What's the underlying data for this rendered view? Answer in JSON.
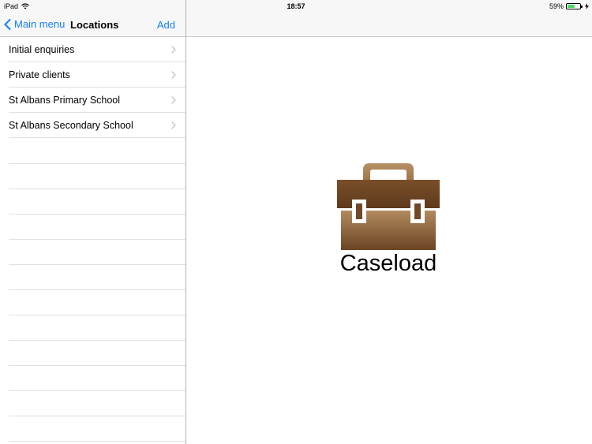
{
  "status_bar": {
    "device": "iPad",
    "time": "18:57",
    "battery_percent_label": "59%",
    "battery_level": 0.59,
    "icons": [
      "wifi-icon",
      "battery-icon",
      "charging-icon"
    ]
  },
  "master": {
    "back_label": "Main menu",
    "title": "Locations",
    "add_label": "Add",
    "items": [
      {
        "label": "Initial enquiries"
      },
      {
        "label": "Private clients"
      },
      {
        "label": "St Albans Primary School"
      },
      {
        "label": "St Albans Secondary School"
      }
    ]
  },
  "detail": {
    "app_name": "Caseload",
    "logo_icon": "briefcase-icon"
  },
  "colors": {
    "tint": "#157efb",
    "nav_background": "#f7f7f7",
    "separator": "#e0e0e0",
    "briefcase_dark": "#6b4423",
    "briefcase_light": "#b38a5e",
    "battery_green": "#4cd964"
  }
}
